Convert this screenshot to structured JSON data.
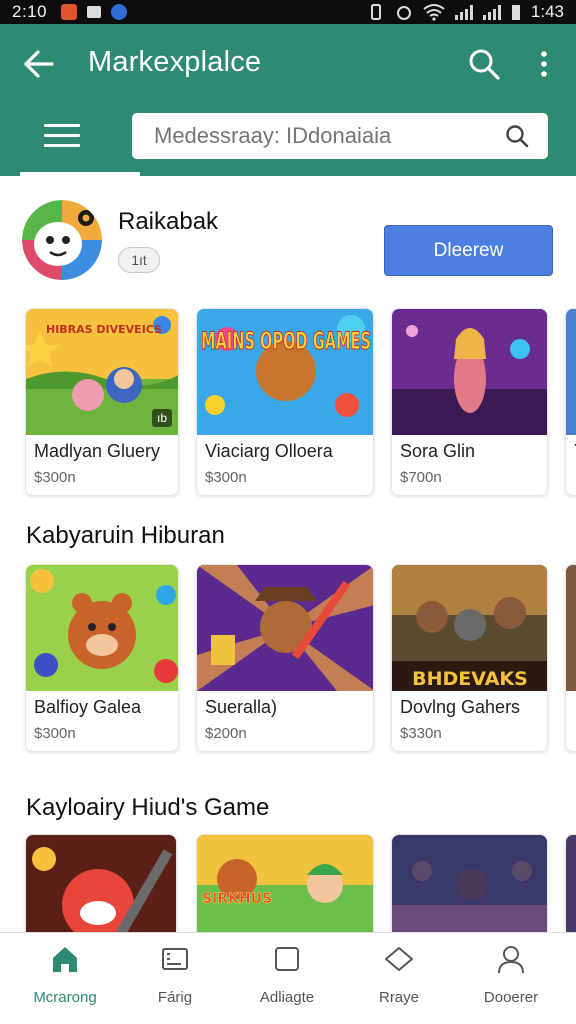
{
  "status_bar": {
    "time": "2:10",
    "clock_right": "1:43"
  },
  "app_bar": {
    "title": "Markexplalce",
    "search_placeholder": "Medessraay: IDdonaiaia"
  },
  "featured": {
    "name": "Raikabak",
    "chip": "1ıt",
    "button": "Dleerew"
  },
  "sections": [
    {
      "title": "",
      "cards": [
        {
          "name": "Madlyan Gluery",
          "price": "$300n",
          "badge": "ıb"
        },
        {
          "name": "Viaciarg Olloera",
          "price": "$300n"
        },
        {
          "name": "Sora Glin",
          "price": "$700n"
        },
        {
          "name": "Y",
          "price": ""
        }
      ]
    },
    {
      "title": "Kabyaruin Hiburan",
      "cards": [
        {
          "name": "Balfioy Galea",
          "price": "$300n"
        },
        {
          "name": "Sueralla)",
          "price": "$200n"
        },
        {
          "name": "Dovlng Gahers",
          "price": "$330n"
        },
        {
          "name": "",
          "price": ""
        }
      ]
    },
    {
      "title": "Kayloairy Hiud's Game",
      "cards": [
        {
          "name": "",
          "price": ""
        },
        {
          "name": "",
          "price": ""
        },
        {
          "name": "",
          "price": ""
        }
      ]
    }
  ],
  "art_text": {
    "card2": "MAINS OPOD GAMES",
    "card6": "BHDEVAKS",
    "card8": "SIRKHUS",
    "card1": "HIBRAS DIVEVEICS"
  },
  "bottom_nav": [
    {
      "label": "Mcrarong",
      "icon": "home-icon",
      "active": true
    },
    {
      "label": "Fárig",
      "icon": "card-icon"
    },
    {
      "label": "Adliagte",
      "icon": "square-icon"
    },
    {
      "label": "Rraye",
      "icon": "diamond-icon"
    },
    {
      "label": "Dooerer",
      "icon": "person-icon"
    }
  ],
  "colors": {
    "primary": "#2e8a73",
    "button": "#4b80e0"
  }
}
